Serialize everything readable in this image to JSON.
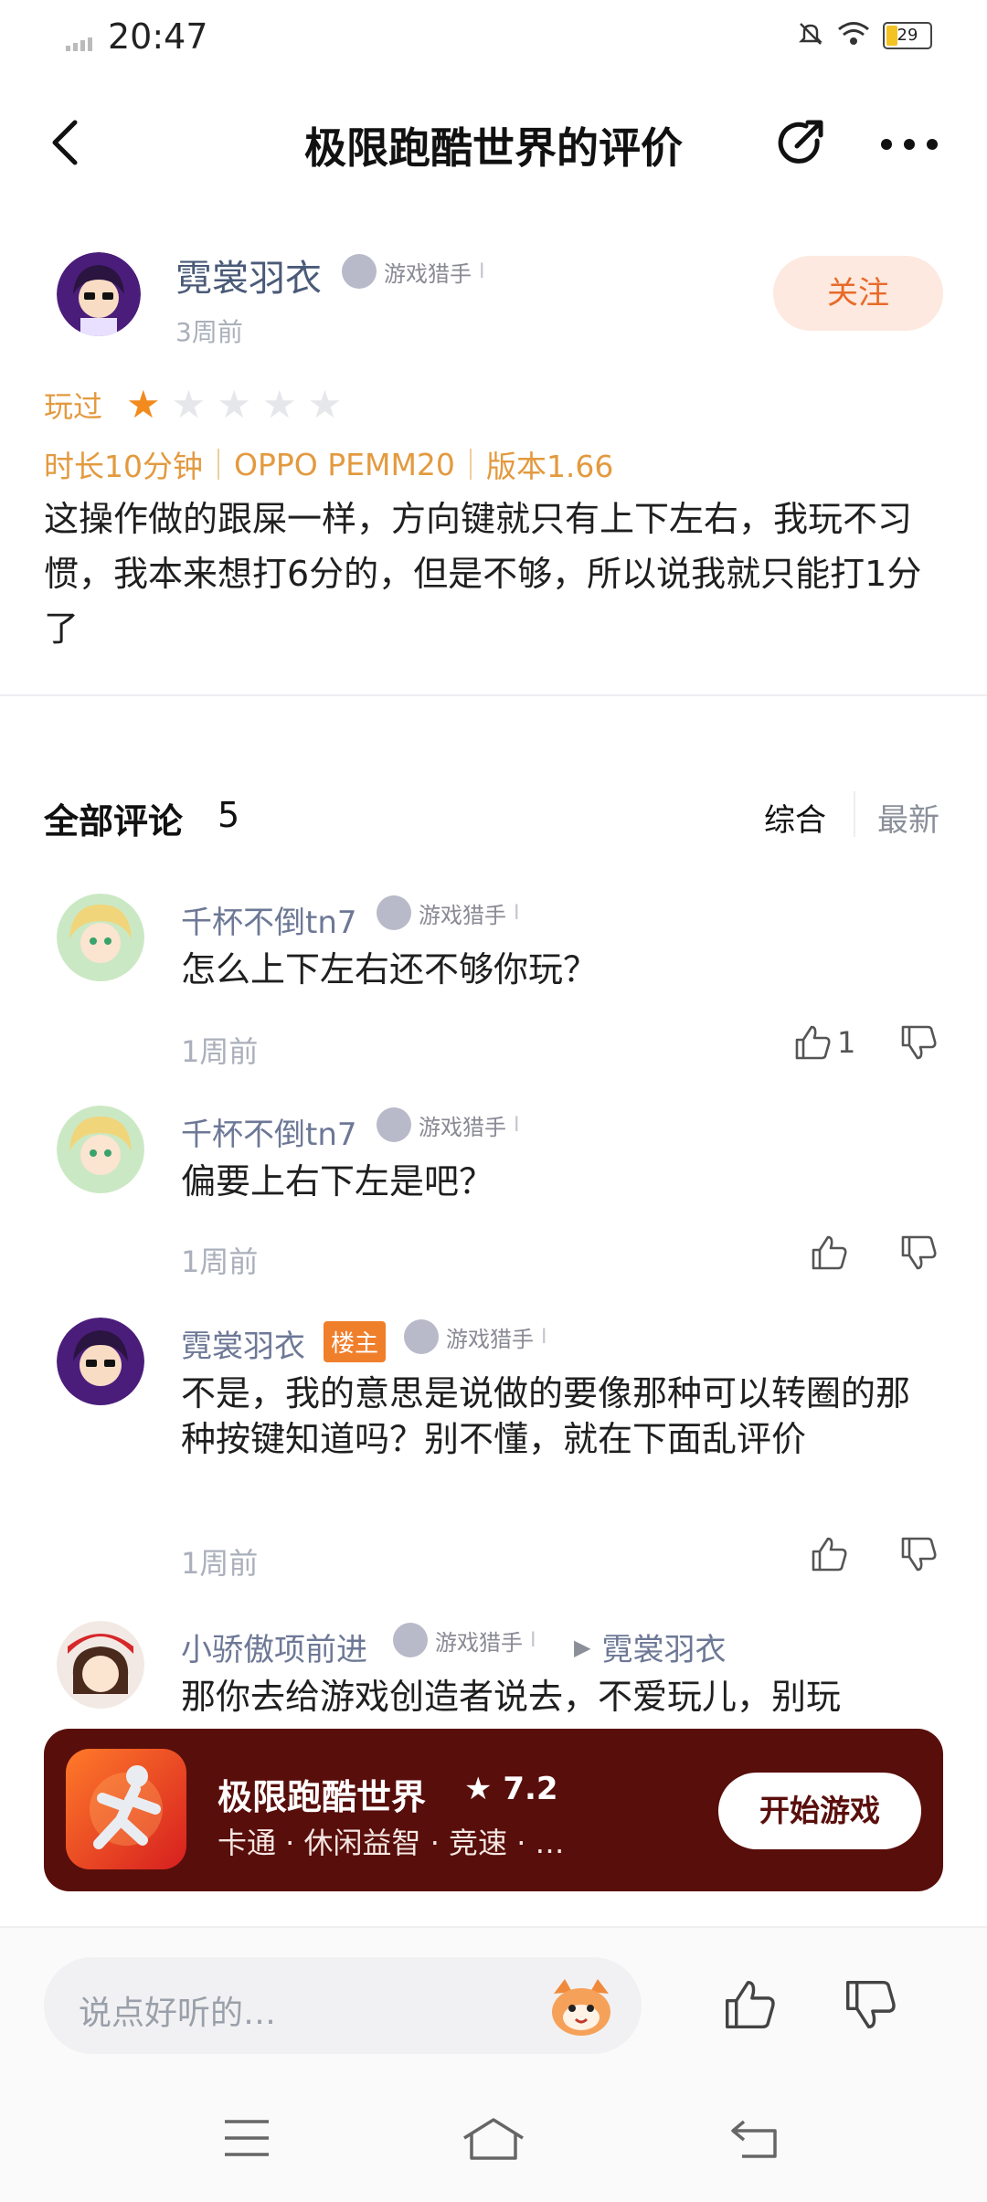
{
  "status_bar": {
    "time": "20:47",
    "battery": "29"
  },
  "header": {
    "title": "极限跑酷世界的评价"
  },
  "review": {
    "author": "霓裳羽衣",
    "badge": "游戏猎手",
    "time": "3周前",
    "follow_label": "关注",
    "played_label": "玩过",
    "rating": 1,
    "rating_max": 5,
    "duration": "时长10分钟",
    "device": "OPPO PEMM20",
    "version": "版本1.66",
    "text": "这操作做的跟屎一样，方向键就只有上下左右，我玩不习惯，我本来想打6分的，但是不够，所以说我就只能打1分了"
  },
  "comments_header": {
    "title": "全部评论",
    "count": "5",
    "sort_active": "综合",
    "sort_other": "最新"
  },
  "comments": [
    {
      "name": "千杯不倒tn7",
      "badge": "游戏猎手",
      "text": "怎么上下左右还不够你玩？",
      "time": "1周前",
      "likes": "1"
    },
    {
      "name": "千杯不倒tn7",
      "badge": "游戏猎手",
      "text": "偏要上右下左是吧？",
      "time": "1周前",
      "likes": ""
    },
    {
      "name": "霓裳羽衣",
      "op_tag": "楼主",
      "badge": "游戏猎手",
      "text": "不是，我的意思是说做的要像那种可以转圈的那种按键知道吗？别不懂，就在下面乱评价",
      "time": "1周前",
      "likes": ""
    },
    {
      "name": "小骄傲项前进",
      "badge": "游戏猎手",
      "reply_to": "霓裳羽衣",
      "text": "那你去给游戏创造者说去，不爱玩儿，别玩"
    }
  ],
  "app_banner": {
    "name": "极限跑酷世界",
    "rating": "7.2",
    "tags": "卡通 · 休闲益智 · 竞速 · …",
    "start_label": "开始游戏"
  },
  "input": {
    "placeholder": "说点好听的…"
  },
  "colors": {
    "accent_orange": "#e86a2a",
    "banner_bg": "#580e0b",
    "star_active": "#f28a1e",
    "star_inactive": "#e6e7eb"
  }
}
